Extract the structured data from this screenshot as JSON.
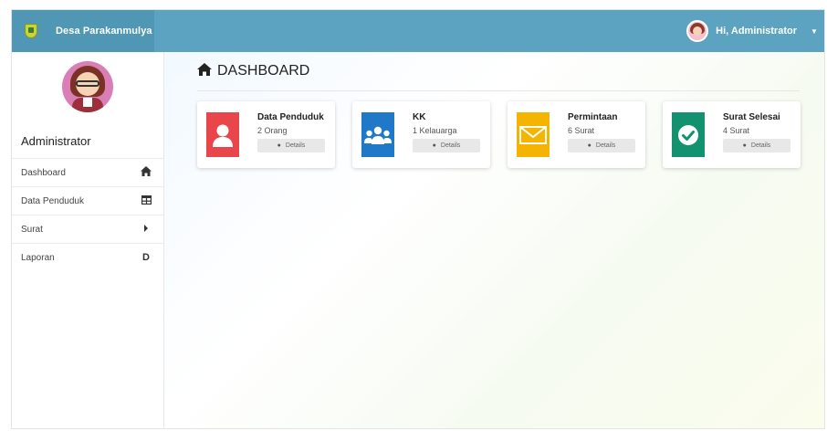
{
  "topbar": {
    "brand_name": "Desa Parakanmulya",
    "user_greeting": "Hi, Administrator",
    "caret_icon": "caret-down-icon",
    "brand_color": "#5ba3c0"
  },
  "sidebar": {
    "profile_name": "Administrator",
    "items": [
      {
        "label": "Dashboard",
        "icon": "home-icon",
        "glyph": "🏠"
      },
      {
        "label": "Data Penduduk",
        "icon": "table-icon",
        "glyph": "⊞"
      },
      {
        "label": "Surat",
        "icon": "caret-right-icon",
        "glyph": "▸"
      },
      {
        "label": "Laporan",
        "icon": "document-icon",
        "glyph": "D"
      }
    ]
  },
  "main": {
    "page_title": "DASHBOARD",
    "cards": [
      {
        "title": "Data Penduduk",
        "value": "2 Orang",
        "button": "Details",
        "icon": "user-icon",
        "color": "#e8464b"
      },
      {
        "title": "KK",
        "value": "1 Kelauarga",
        "button": "Details",
        "icon": "users-icon",
        "color": "#1f78c8"
      },
      {
        "title": "Permintaan",
        "value": "6 Surat",
        "button": "Details",
        "icon": "envelope-icon",
        "color": "#f4b400"
      },
      {
        "title": "Surat Selesai",
        "value": "4 Surat",
        "button": "Details",
        "icon": "check-circle-icon",
        "color": "#12926e"
      }
    ]
  }
}
